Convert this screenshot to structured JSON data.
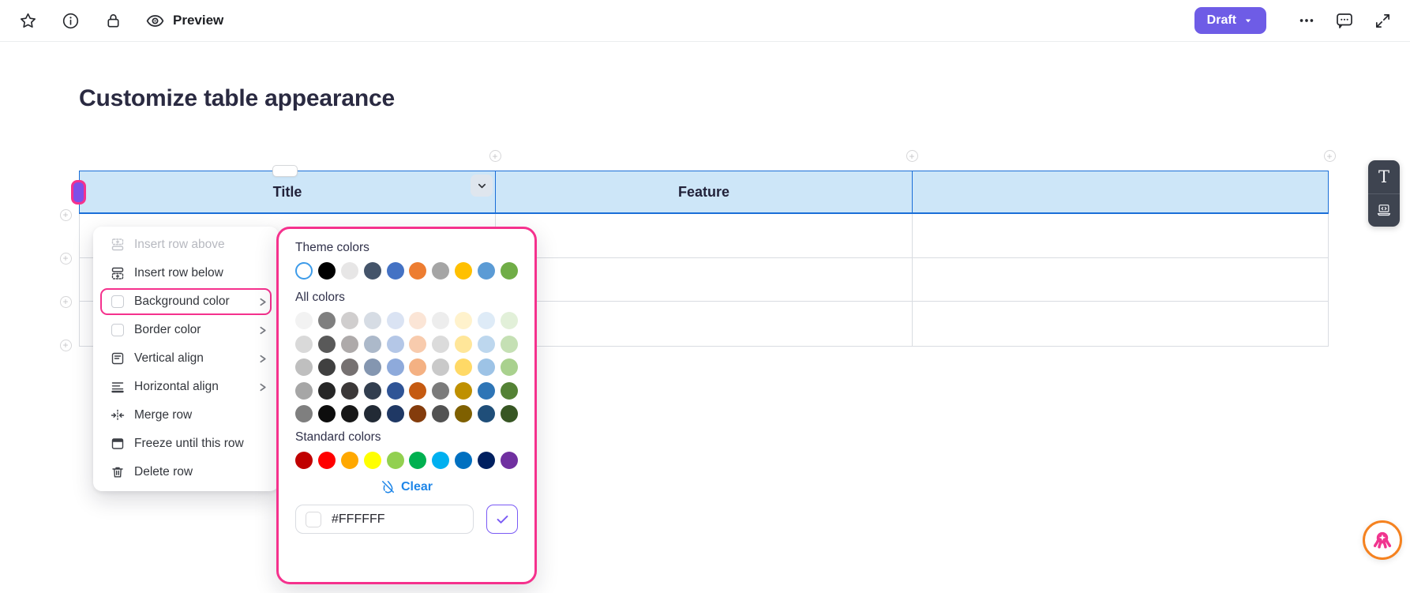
{
  "topbar": {
    "preview_label": "Preview",
    "draft_label": "Draft",
    "left_icons": [
      "star-icon",
      "info-icon",
      "lock-icon",
      "eye-icon"
    ],
    "right_icons": [
      "more-icon",
      "comment-icon",
      "expand-icon"
    ]
  },
  "page": {
    "title": "Customize table appearance"
  },
  "table": {
    "columns": [
      "Title",
      "Feature",
      ""
    ],
    "body_rows": 3,
    "header_fill": "#CDE6F8",
    "header_border": "#1A6ED8"
  },
  "context_menu": {
    "items": [
      {
        "label": "Insert row above",
        "icon": "insert-row-above-icon",
        "disabled": true,
        "submenu": false,
        "highlighted": false
      },
      {
        "label": "Insert row below",
        "icon": "insert-row-below-icon",
        "disabled": false,
        "submenu": false,
        "highlighted": false
      },
      {
        "label": "Background color",
        "icon": "color-swatch-icon",
        "disabled": false,
        "submenu": true,
        "highlighted": true
      },
      {
        "label": "Border color",
        "icon": "color-swatch-icon",
        "disabled": false,
        "submenu": true,
        "highlighted": false
      },
      {
        "label": "Vertical align",
        "icon": "vertical-align-icon",
        "disabled": false,
        "submenu": true,
        "highlighted": false
      },
      {
        "label": "Horizontal align",
        "icon": "horizontal-align-icon",
        "disabled": false,
        "submenu": true,
        "highlighted": false
      },
      {
        "label": "Merge row",
        "icon": "merge-row-icon",
        "disabled": false,
        "submenu": false,
        "highlighted": false
      },
      {
        "label": "Freeze until this row",
        "icon": "freeze-row-icon",
        "disabled": false,
        "submenu": false,
        "highlighted": false
      },
      {
        "label": "Delete row",
        "icon": "trash-icon",
        "disabled": false,
        "submenu": false,
        "highlighted": false
      }
    ]
  },
  "color_picker": {
    "theme_title": "Theme colors",
    "all_title": "All colors",
    "standard_title": "Standard colors",
    "clear_label": "Clear",
    "hex_value": "#FFFFFF",
    "selected_theme_index": 0,
    "theme_colors": [
      "#FFFFFF",
      "#000000",
      "#E7E6E6",
      "#44546A",
      "#4472C4",
      "#ED7D31",
      "#A5A5A5",
      "#FFC000",
      "#5B9BD5",
      "#70AD47"
    ],
    "all_colors": [
      [
        "#F2F2F2",
        "#7F7F7F",
        "#D0CECE",
        "#D6DCE4",
        "#DAE3F3",
        "#FBE5D6",
        "#EDEDED",
        "#FFF2CC",
        "#DEEBF7",
        "#E2F0D9"
      ],
      [
        "#D9D9D9",
        "#595959",
        "#AEAAAA",
        "#ACB9CA",
        "#B4C7E7",
        "#F8CBAD",
        "#DBDBDB",
        "#FFE699",
        "#BDD7EE",
        "#C5E0B4"
      ],
      [
        "#BFBFBF",
        "#404040",
        "#767171",
        "#8496B0",
        "#8EAADB",
        "#F4B183",
        "#C9C9C9",
        "#FFD966",
        "#9DC3E6",
        "#A9D18E"
      ],
      [
        "#A6A6A6",
        "#262626",
        "#3B3838",
        "#323E4F",
        "#2F5496",
        "#C55A11",
        "#7B7B7B",
        "#BF9000",
        "#2E75B6",
        "#548235"
      ],
      [
        "#7F7F7F",
        "#0D0D0D",
        "#171717",
        "#222A35",
        "#1F3864",
        "#843C0C",
        "#525252",
        "#7F6000",
        "#1F4E79",
        "#375623"
      ]
    ],
    "standard_colors": [
      "#C00000",
      "#FF0000",
      "#FFA800",
      "#FFFF00",
      "#92D050",
      "#00B050",
      "#00B0F0",
      "#0070C0",
      "#002060",
      "#7030A0"
    ]
  },
  "side_dock": {
    "text_tool_label": "T",
    "icons": [
      "text-tool-icon",
      "embed-laptop-icon"
    ]
  },
  "mascot": {
    "icon": "octopus-mascot-icon"
  },
  "colors": {
    "accent_pink": "#F5318D",
    "accent_purple": "#7E4FE8",
    "draft_purple": "#6E5CE6",
    "link_blue": "#1E86E8",
    "confirm_purple": "#7A5AF5",
    "header_fill": "#CDE6F8",
    "header_border": "#1A6ED8",
    "mascot_orange": "#F58220",
    "mascot_pink": "#F0358F"
  }
}
